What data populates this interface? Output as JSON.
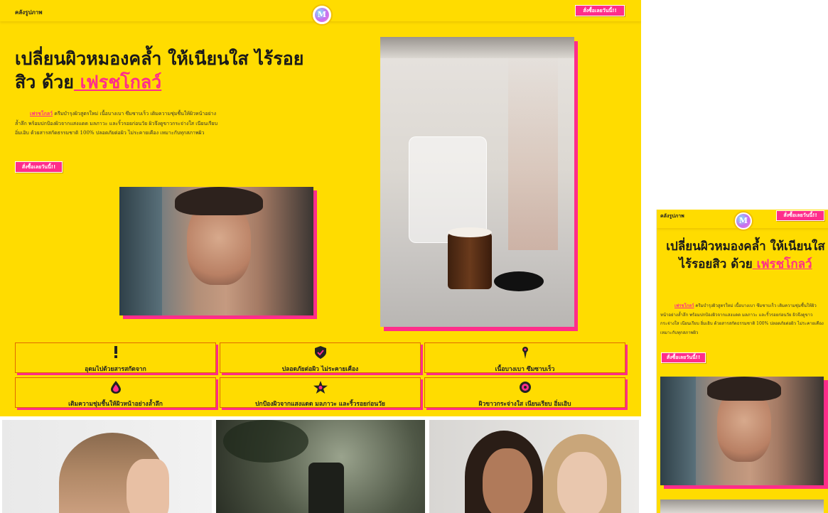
{
  "header": {
    "nav_gallery": "คลังรูปภาพ",
    "logo_text": "M",
    "order_button": "สั่งซื้อเลยวันนี้!!"
  },
  "hero": {
    "title_line": "เปลี่ยนผิวหมองคล้ำ ให้เนียนใส ไร้รอยสิว ด้วย",
    "brand": " เฟรชโกลว์",
    "brand_inline": "เฟรชโกลว์",
    "description": " ครีมบำรุงผิวสูตรใหม่ เนื้อบางเบา ซึมซาบเร็ว เติมความชุ่มชื้นให้ผิวหน้าอย่างล้ำลึก พร้อมปกป้องผิวจากแสงแดด มลภาวะ และริ้วรอยก่อนวัย ผิวจึงดูขาวกระจ่างใส เนียนเรียบ อิ่มเอิบ ด้วยสารสกัดธรรมชาติ 100% ปลอดภัยต่อผิว ไม่ระคายเคือง เหมาะกับทุกสภาพผิว",
    "cta": "สั่งซื้อเลยวันนี้!!"
  },
  "features": [
    {
      "label": "อุดมไปด้วยสารสกัดจาก",
      "icon": "exclamation-icon"
    },
    {
      "label": "ปลอดภัยต่อผิว ไม่ระคายเคือง",
      "icon": "shield-check-icon"
    },
    {
      "label": "เนื้อบางเบา ซึมซาบเร็ว",
      "icon": "map-pin-icon"
    },
    {
      "label": "เติมความชุ่มชื้นให้ผิวหน้าอย่างล้ำลึก",
      "icon": "droplet-icon"
    },
    {
      "label": "ปกป้องผิวจากแสงแดด มลภาวะ และริ้วรอยก่อนวัย",
      "icon": "star-icon"
    },
    {
      "label": "ผิวขาวกระจ่างใส เนียนเรียบ อิ่มเอิบ",
      "icon": "sun-icon"
    }
  ],
  "colors": {
    "background": "#ffdc00",
    "accent": "#ff2d8a",
    "text": "#1a1a1a"
  }
}
